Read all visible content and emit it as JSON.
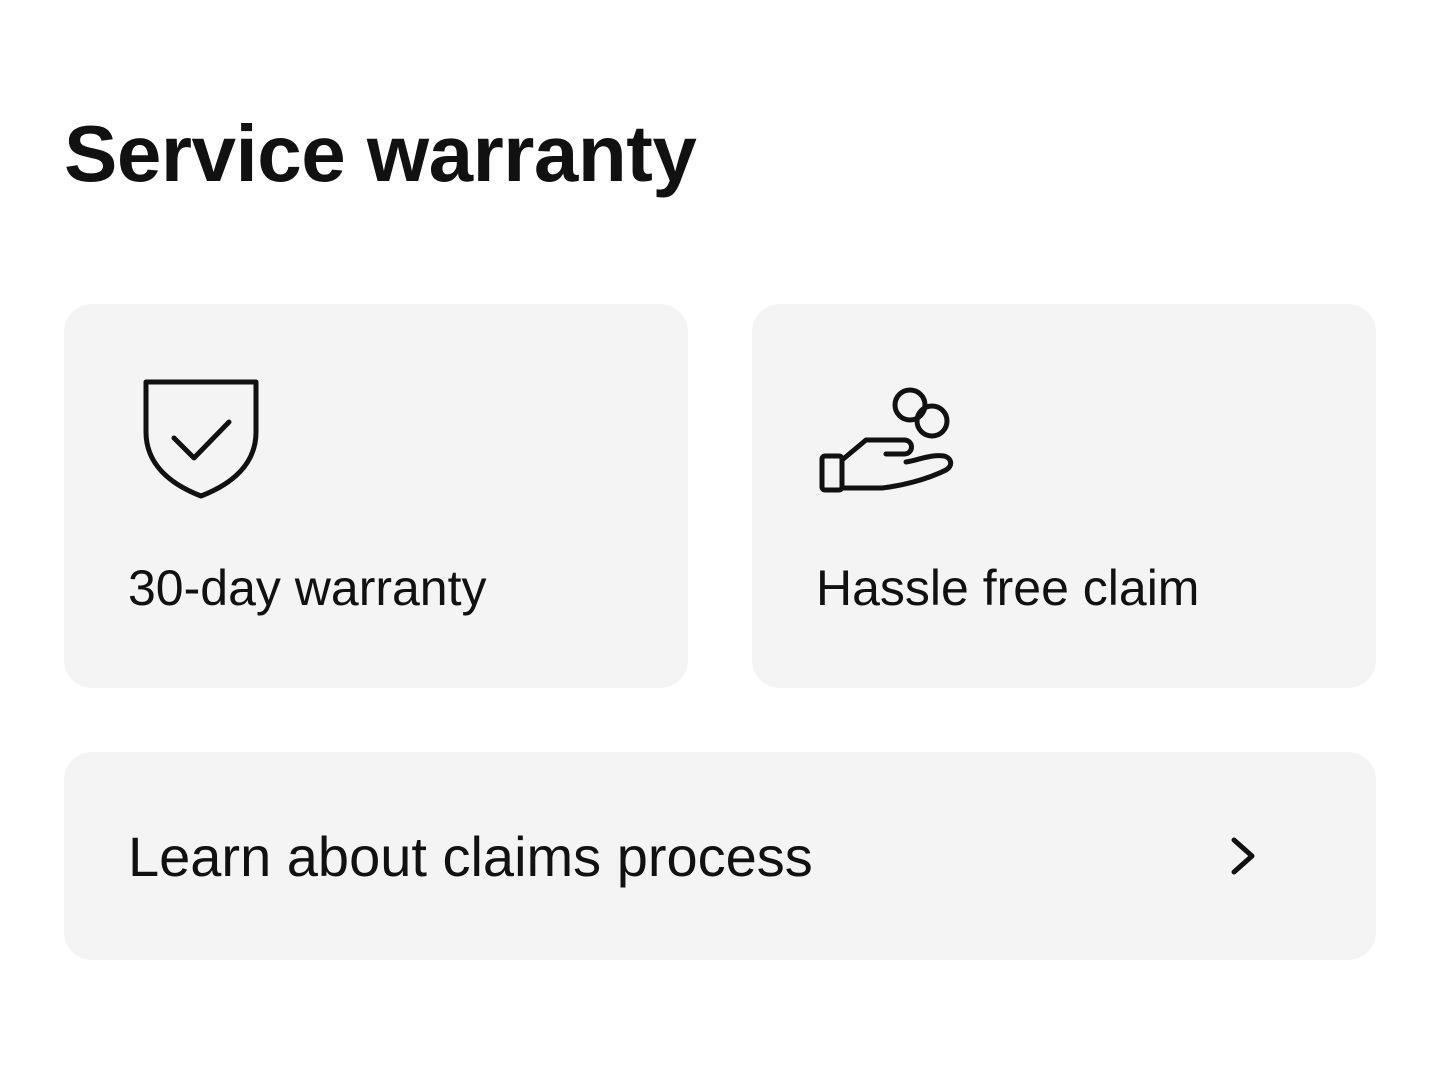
{
  "section": {
    "title": "Service warranty"
  },
  "features": [
    {
      "label": "30-day warranty",
      "icon": "shield-check-icon"
    },
    {
      "label": "Hassle free claim",
      "icon": "hand-coins-icon"
    }
  ],
  "claims_link": {
    "label": "Learn about claims process",
    "icon": "chevron-right-icon"
  },
  "colors": {
    "text": "#111111",
    "card_background": "#f4f4f4",
    "page_background": "#ffffff"
  }
}
